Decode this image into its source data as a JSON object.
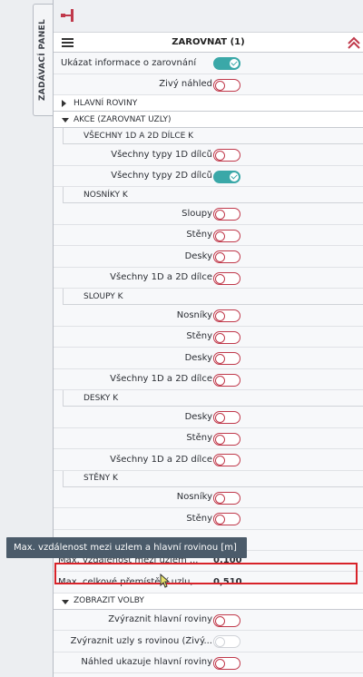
{
  "side_tab": {
    "label": "ZADÁVACÍ PANEL"
  },
  "header": {
    "title": "ZAROVNAT (1)"
  },
  "top_options": [
    {
      "label": "Ukázat informace o zarovnání",
      "state": "on"
    },
    {
      "label": "Živý náhled",
      "state": "off"
    }
  ],
  "sections": {
    "hlavni_roviny": "HLAVNÍ ROVINY",
    "akce": "AKCE (ZAROVNAT UZLY)",
    "zobrazit_volby": "ZOBRAZIT VOLBY"
  },
  "groups": {
    "vsechny": {
      "title": "VŠECHNY 1D A 2D DÍLCE K",
      "items": [
        {
          "label": "Všechny typy 1D dílců",
          "state": "off"
        },
        {
          "label": "Všechny typy 2D dílců",
          "state": "on"
        }
      ]
    },
    "nosniky": {
      "title": "NOSNÍKY K",
      "items": [
        {
          "label": "Sloupy",
          "state": "off"
        },
        {
          "label": "Stěny",
          "state": "off"
        },
        {
          "label": "Desky",
          "state": "off"
        },
        {
          "label": "Všechny 1D a 2D dílce",
          "state": "off"
        }
      ]
    },
    "sloupy": {
      "title": "SLOUPY K",
      "items": [
        {
          "label": "Nosníky",
          "state": "off"
        },
        {
          "label": "Stěny",
          "state": "off"
        },
        {
          "label": "Desky",
          "state": "off"
        },
        {
          "label": "Všechny 1D a 2D dílce",
          "state": "off"
        }
      ]
    },
    "desky": {
      "title": "DESKY K",
      "items": [
        {
          "label": "Desky",
          "state": "off"
        },
        {
          "label": "Stěny",
          "state": "off"
        },
        {
          "label": "Všechny 1D a 2D dílce",
          "state": "off"
        }
      ]
    },
    "steny": {
      "title": "STĚNY K",
      "items": [
        {
          "label": "Nosníky",
          "state": "off"
        },
        {
          "label": "Stěny",
          "state": "off"
        }
      ]
    }
  },
  "tooltip": "Max. vzdálenost mezi uzlem a hlavní rovinou [m]",
  "params": [
    {
      "label": "Max. vzdálenost mezi uzlem ...",
      "value": "0,100"
    },
    {
      "label": "Max. celkové přemístění uzlu,...",
      "value": "0,510"
    }
  ],
  "display_options": [
    {
      "label": "Zvýraznit hlavní roviny",
      "state": "off"
    },
    {
      "label": "Zvýraznit uzly s rovinou (Živý...",
      "state": "disabled"
    },
    {
      "label": "Náhled ukazuje hlavní roviny",
      "state": "off"
    }
  ],
  "colors": {
    "toggle_on": "#3aa8a8",
    "toggle_off": "#c0394b",
    "highlight": "#d8232a",
    "tooltip_bg": "#4b5b6a"
  }
}
